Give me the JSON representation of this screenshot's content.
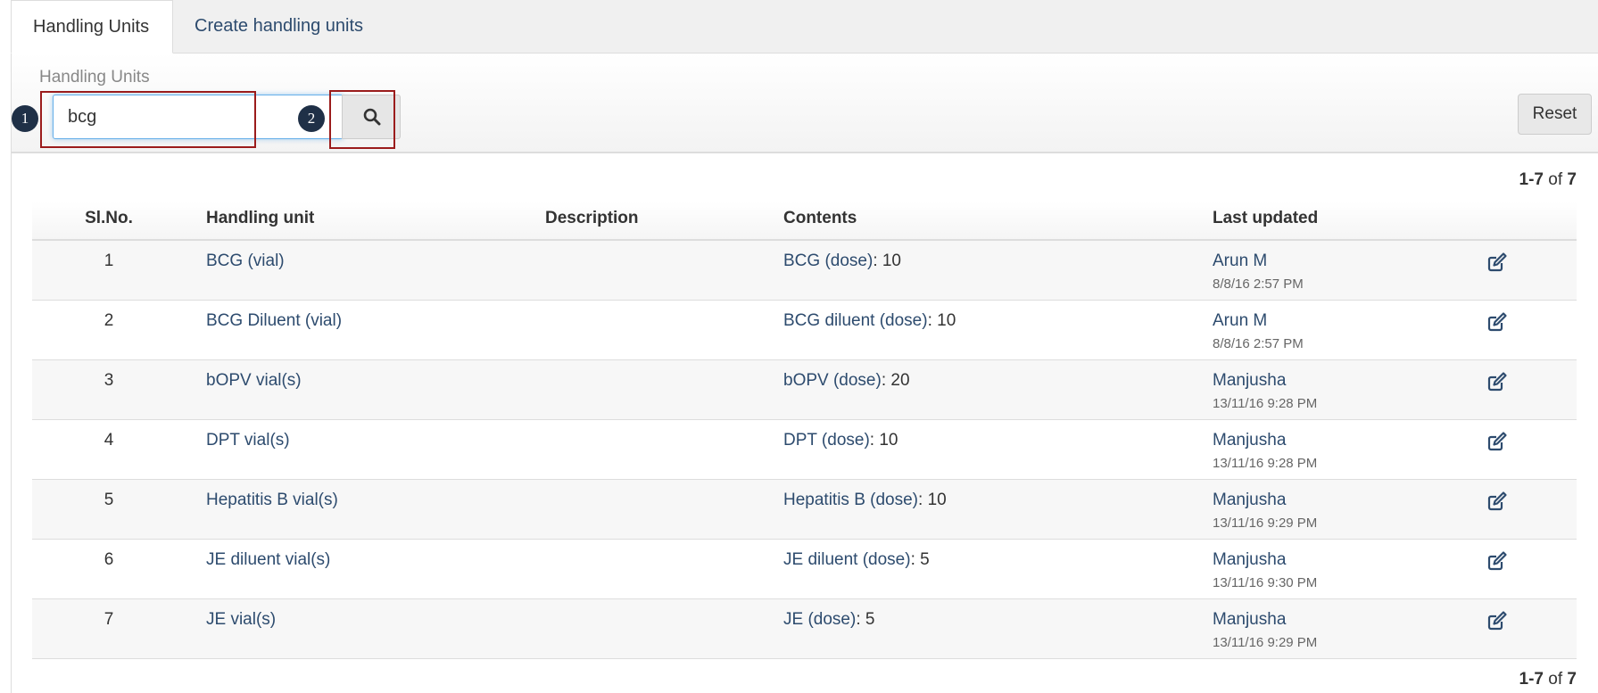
{
  "tabs": [
    {
      "label": "Handling Units",
      "active": true
    },
    {
      "label": "Create handling units",
      "active": false
    }
  ],
  "filter": {
    "label": "Handling Units",
    "search_value": "bcg",
    "search_icon": "search-icon",
    "reset_label": "Reset"
  },
  "callouts": {
    "marker1": "1",
    "marker2": "2"
  },
  "pagination": {
    "range": "1-7",
    "of_word": "of",
    "total": "7"
  },
  "table": {
    "headers": {
      "sl_no": "Sl.No.",
      "handling_unit": "Handling unit",
      "description": "Description",
      "contents": "Contents",
      "last_updated": "Last updated"
    },
    "rows": [
      {
        "sl": "1",
        "unit": "BCG (vial)",
        "description": "",
        "content_name": "BCG (dose)",
        "content_qty": ": 10",
        "updated_by": "Arun M",
        "updated_at": "8/8/16 2:57 PM"
      },
      {
        "sl": "2",
        "unit": "BCG Diluent (vial)",
        "description": "",
        "content_name": "BCG diluent (dose)",
        "content_qty": ": 10",
        "updated_by": "Arun M",
        "updated_at": "8/8/16 2:57 PM"
      },
      {
        "sl": "3",
        "unit": "bOPV vial(s)",
        "description": "",
        "content_name": "bOPV (dose)",
        "content_qty": ": 20",
        "updated_by": "Manjusha",
        "updated_at": "13/11/16 9:28 PM"
      },
      {
        "sl": "4",
        "unit": "DPT vial(s)",
        "description": "",
        "content_name": "DPT (dose)",
        "content_qty": ": 10",
        "updated_by": "Manjusha",
        "updated_at": "13/11/16 9:28 PM"
      },
      {
        "sl": "5",
        "unit": "Hepatitis B vial(s)",
        "description": "",
        "content_name": "Hepatitis B (dose)",
        "content_qty": ": 10",
        "updated_by": "Manjusha",
        "updated_at": "13/11/16 9:29 PM"
      },
      {
        "sl": "6",
        "unit": "JE diluent vial(s)",
        "description": "",
        "content_name": "JE diluent (dose)",
        "content_qty": ": 5",
        "updated_by": "Manjusha",
        "updated_at": "13/11/16 9:30 PM"
      },
      {
        "sl": "7",
        "unit": "JE vial(s)",
        "description": "",
        "content_name": "JE (dose)",
        "content_qty": ": 5",
        "updated_by": "Manjusha",
        "updated_at": "13/11/16 9:29 PM"
      }
    ],
    "edit_icon": "edit-icon"
  },
  "colors": {
    "link": "#2d4b6e",
    "callout": "#9b1c1c",
    "marker": "#1f3047",
    "focus": "#66afe9"
  }
}
